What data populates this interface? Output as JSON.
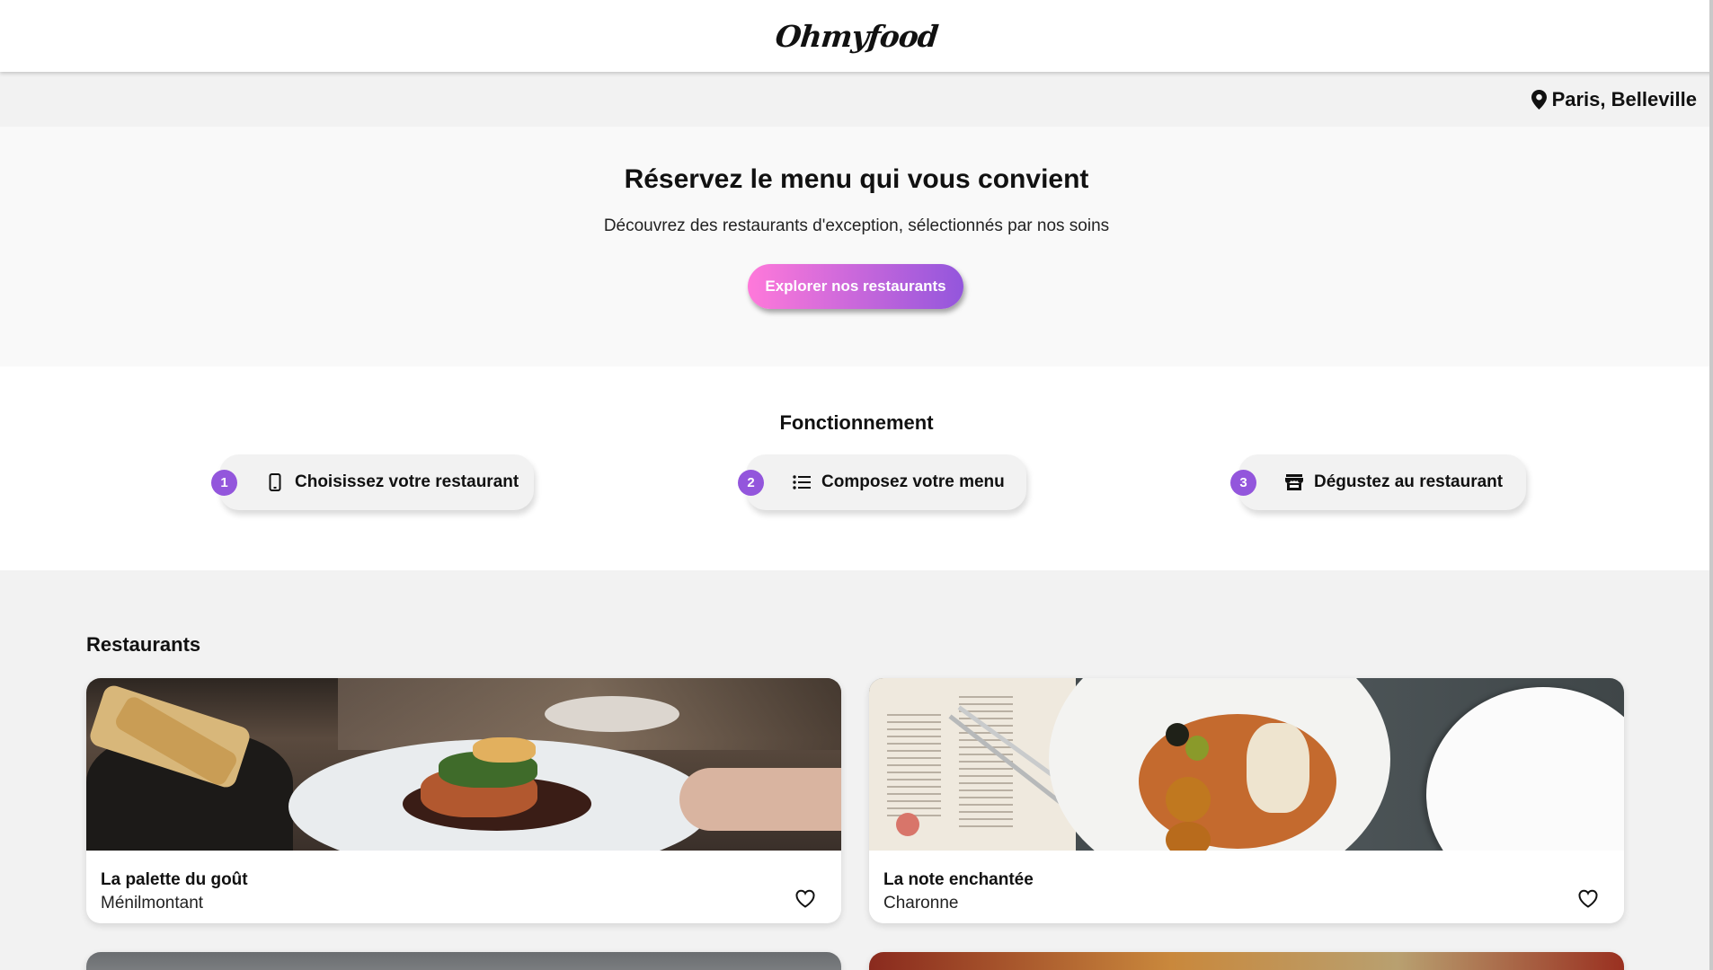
{
  "header": {
    "logo": "Ohmyfood"
  },
  "location": {
    "text": "Paris, Belleville",
    "icon": "map-pin-icon"
  },
  "hero": {
    "title": "Réservez le menu qui vous convient",
    "subtitle": "Découvrez des restaurants d'exception, sélectionnés par nos soins",
    "button_label": "Explorer nos restaurants",
    "button_colors": [
      "#ff79da",
      "#9356dc"
    ]
  },
  "how": {
    "title": "Fonctionnement",
    "steps": [
      {
        "number": "1",
        "icon": "phone-icon",
        "label": "Choisissez votre restaurant"
      },
      {
        "number": "2",
        "icon": "list-icon",
        "label": "Composez votre menu"
      },
      {
        "number": "3",
        "icon": "store-icon",
        "label": "Dégustez au restaurant"
      }
    ],
    "accent": "#9356dc"
  },
  "restaurants": {
    "title": "Restaurants",
    "items": [
      {
        "name": "La palette du goût",
        "area": "Ménilmontant",
        "icon": "heart-icon"
      },
      {
        "name": "La note enchantée",
        "area": "Charonne",
        "icon": "heart-icon"
      }
    ]
  }
}
